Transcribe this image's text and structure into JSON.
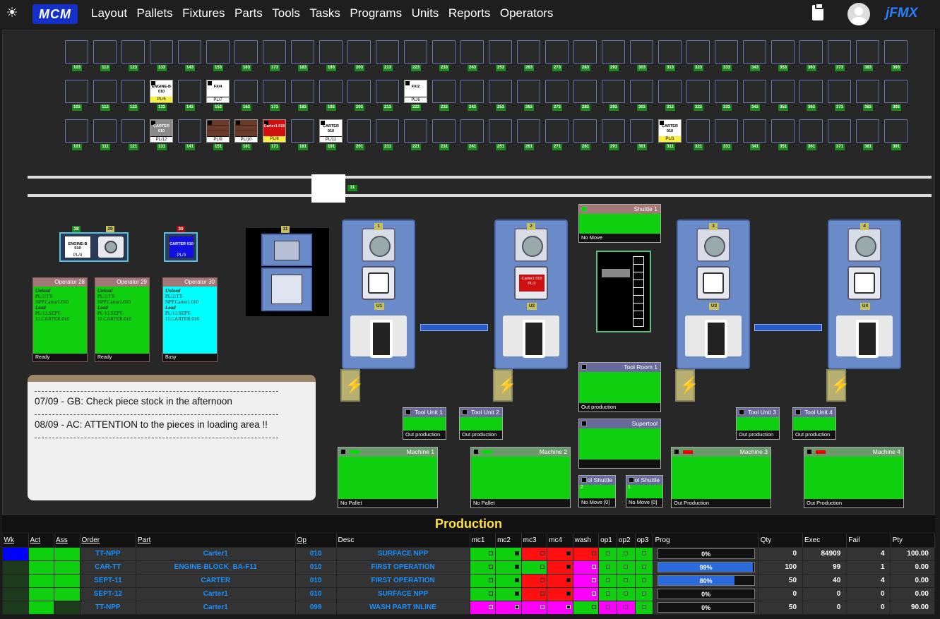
{
  "nav": {
    "items": [
      "Layout",
      "Pallets",
      "Fixtures",
      "Parts",
      "Tools",
      "Tasks",
      "Programs",
      "Units",
      "Reports",
      "Operators"
    ],
    "brand": "jFMX",
    "logo": "MCM"
  },
  "stocker": {
    "row_top": [
      "103",
      "113",
      "123",
      "133",
      "143",
      "153",
      "163",
      "173",
      "183",
      "193",
      "203",
      "213",
      "223",
      "233",
      "243",
      "253",
      "263",
      "273",
      "283",
      "293",
      "303",
      "313",
      "323",
      "333",
      "343",
      "353",
      "363",
      "373",
      "383",
      "393"
    ],
    "row_mid": [
      "102",
      "112",
      "122",
      "132",
      "142",
      "152",
      "162",
      "172",
      "182",
      "192",
      "202",
      "212",
      "222",
      "232",
      "242",
      "252",
      "262",
      "272",
      "282",
      "292",
      "302",
      "312",
      "322",
      "332",
      "342",
      "352",
      "362",
      "372",
      "382",
      "392"
    ],
    "row_bot": [
      "101",
      "111",
      "121",
      "131",
      "141",
      "151",
      "161",
      "171",
      "181",
      "191",
      "201",
      "211",
      "221",
      "231",
      "241",
      "251",
      "261",
      "271",
      "281",
      "291",
      "301",
      "311",
      "321",
      "331",
      "341",
      "351",
      "361",
      "371",
      "381",
      "391"
    ],
    "pallets": [
      {
        "slot": "132",
        "text": "ENGINE-B 010",
        "pl": "PL/5",
        "style": "white-yellow"
      },
      {
        "slot": "152",
        "text": "FX/4",
        "pl": "PL/7",
        "style": "white"
      },
      {
        "slot": "222",
        "text": "FX/2",
        "pl": "PL/6",
        "style": "white"
      },
      {
        "slot": "131",
        "text": "CARTER 010",
        "pl": "PL/12",
        "style": "gray"
      },
      {
        "slot": "151",
        "text": "",
        "pl": "PL/9",
        "style": "brown"
      },
      {
        "slot": "161",
        "text": "",
        "pl": "PL/10",
        "style": "brown"
      },
      {
        "slot": "171",
        "text": "Carter1 010",
        "pl": "PL/8",
        "style": "red"
      },
      {
        "slot": "191",
        "text": "CARTER 010",
        "pl": "PL/11",
        "style": "white"
      },
      {
        "slot": "311",
        "text": "CARTER 010",
        "pl": "PL/1",
        "style": "white-yellow"
      }
    ],
    "shuttle_tag": "31"
  },
  "stations": {
    "tags": [
      "28",
      "29",
      "30",
      "11"
    ],
    "load28": {
      "text": "ENGINE-B 010",
      "pl": "PL/4"
    },
    "load30": {
      "text": "CARTER 010",
      "pl": "PL/3"
    }
  },
  "operators": [
    {
      "title": "Operator 28",
      "unload": "Unload",
      "unload_text": "PL/2:TT-NPP.Carter1.010",
      "load": "Load",
      "load_text": "PL/11:SEPT-11.CARTER.010",
      "status": "Ready",
      "color": "#0fd00f"
    },
    {
      "title": "Operator 29",
      "unload": "Unload",
      "unload_text": "PL/2:TT-NPP.Carter1.010",
      "load": "Load",
      "load_text": "PL/11:SEPT-11.CARTER.010",
      "status": "Ready",
      "color": "#0fd00f"
    },
    {
      "title": "Operator 30",
      "unload": "Unload",
      "unload_text": "PL/2:TT-NPP.Carter1.010",
      "load": "Load",
      "load_text": "PL/11:SEPT-11.CARTER.010",
      "status": "Busy",
      "color": "#00ffff"
    }
  ],
  "messages": [
    "07/09 - GB: Check piece stock in the afternoon",
    "08/09 - AC: ATTENTION to the pieces in loading area !!"
  ],
  "machines": [
    {
      "tag": "1",
      "utag": "U1",
      "pallet": ""
    },
    {
      "tag": "2",
      "utag": "U2",
      "pallet": "Carter1 010 PL/2"
    },
    {
      "tag": "3",
      "utag": "U3",
      "pallet": ""
    },
    {
      "tag": "4",
      "utag": "U4",
      "pallet": ""
    }
  ],
  "units": {
    "shuttle1": {
      "title": "Shuttle 1",
      "status": "No Move"
    },
    "toolroom1": {
      "title": "Tool Room 1",
      "status": "Out production"
    },
    "supertool": {
      "title": "Supertool",
      "status": ""
    },
    "toolunit1": {
      "title": "Tool Unit 1",
      "status": "Out production"
    },
    "toolunit2": {
      "title": "Tool Unit 2",
      "status": "Out production"
    },
    "toolunit3": {
      "title": "Tool Unit 3",
      "status": "Out production"
    },
    "toolunit4": {
      "title": "Tool Unit 4",
      "status": "Out production"
    },
    "toolshuttle2": {
      "title": "ol Shuttle",
      "num": "2",
      "status": "No Move [0]"
    },
    "toolshuttle1": {
      "title": "ol Shuttle",
      "num": "1",
      "status": "No Move [0]"
    },
    "machine1": {
      "title": "Machine 1",
      "status": "No Pallet",
      "led": "green"
    },
    "machine2": {
      "title": "Machine 2",
      "status": "No Pallet",
      "led": "green"
    },
    "machine3": {
      "title": "Machine 3",
      "status": "Out Production",
      "led": "red"
    },
    "machine4": {
      "title": "Machine 4",
      "status": "Out Production",
      "led": "red"
    }
  },
  "production": {
    "title": "Production",
    "columns": [
      "Wk",
      "Act",
      "Ass",
      "Order",
      "Part",
      "Op",
      "Desc",
      "mc1",
      "mc2",
      "mc3",
      "mc4",
      "wash",
      "op1",
      "op2",
      "op3",
      "Prog",
      "Qty",
      "Exec",
      "Fail",
      "Pty"
    ],
    "rows": [
      {
        "order": "TT-NPP",
        "part": "Carter1",
        "op": "010",
        "desc": "SURFACE NPP",
        "prog": "0%",
        "prog_value": 0,
        "qty": "0",
        "exec": "84909",
        "fail": "4",
        "pty": "100.00",
        "wk": "#0000ff",
        "act": "#0fd00f",
        "ass": "#0fd00f",
        "mc": [
          "#0fd00f",
          "#0fd00f",
          "#ff1010",
          "#ff1010",
          "#ff1010"
        ],
        "ops": [
          "#0fd00f",
          "#0fd00f",
          "#0fd00f"
        ]
      },
      {
        "order": "CAR-TT",
        "part": "ENGINE-BLOCK_BA-F11",
        "op": "010",
        "desc": "FIRST OPERATION",
        "prog": "99%",
        "prog_value": 99,
        "qty": "100",
        "exec": "99",
        "fail": "1",
        "pty": "0.00",
        "wk": "#1c3a1c",
        "act": "#0fd00f",
        "ass": "#0fd00f",
        "mc": [
          "#0fd00f",
          "#0fd00f",
          "#0fd00f",
          "#ff1010",
          "#ff00ff"
        ],
        "ops": [
          "#0fd00f",
          "#0fd00f",
          "#0fd00f"
        ]
      },
      {
        "order": "SEPT-11",
        "part": "CARTER",
        "op": "010",
        "desc": "FIRST OPERATION",
        "prog": "80%",
        "prog_value": 80,
        "qty": "50",
        "exec": "40",
        "fail": "4",
        "pty": "0.00",
        "wk": "#1c3a1c",
        "act": "#0fd00f",
        "ass": "#0fd00f",
        "mc": [
          "#0fd00f",
          "#0fd00f",
          "#ff1010",
          "#ff1010",
          "#ff00ff"
        ],
        "ops": [
          "#0fd00f",
          "#0fd00f",
          "#0fd00f"
        ]
      },
      {
        "order": "SEPT-12",
        "part": "Carter1",
        "op": "010",
        "desc": "SURFACE NPP",
        "prog": "0%",
        "prog_value": 0,
        "qty": "0",
        "exec": "0",
        "fail": "0",
        "pty": "0.00",
        "wk": "#1c3a1c",
        "act": "#0fd00f",
        "ass": "#0fd00f",
        "mc": [
          "#0fd00f",
          "#0fd00f",
          "#ff1010",
          "#ff1010",
          "#ff00ff"
        ],
        "ops": [
          "#0fd00f",
          "#0fd00f",
          "#0fd00f"
        ]
      },
      {
        "order": "TT-NPP",
        "part": "Carter1",
        "op": "099",
        "desc": "WASH PART INLINE",
        "prog": "0%",
        "prog_value": 0,
        "qty": "50",
        "exec": "0",
        "fail": "0",
        "pty": "90.00",
        "wk": "#1c3a1c",
        "act": "#0fd00f",
        "ass": "#1c3a1c",
        "mc": [
          "#ff00ff",
          "#ff00ff",
          "#ff00ff",
          "#ff00ff",
          "#0fd00f"
        ],
        "ops": [
          "#ff00ff",
          "#ff00ff",
          "#0fd00f"
        ]
      }
    ]
  }
}
